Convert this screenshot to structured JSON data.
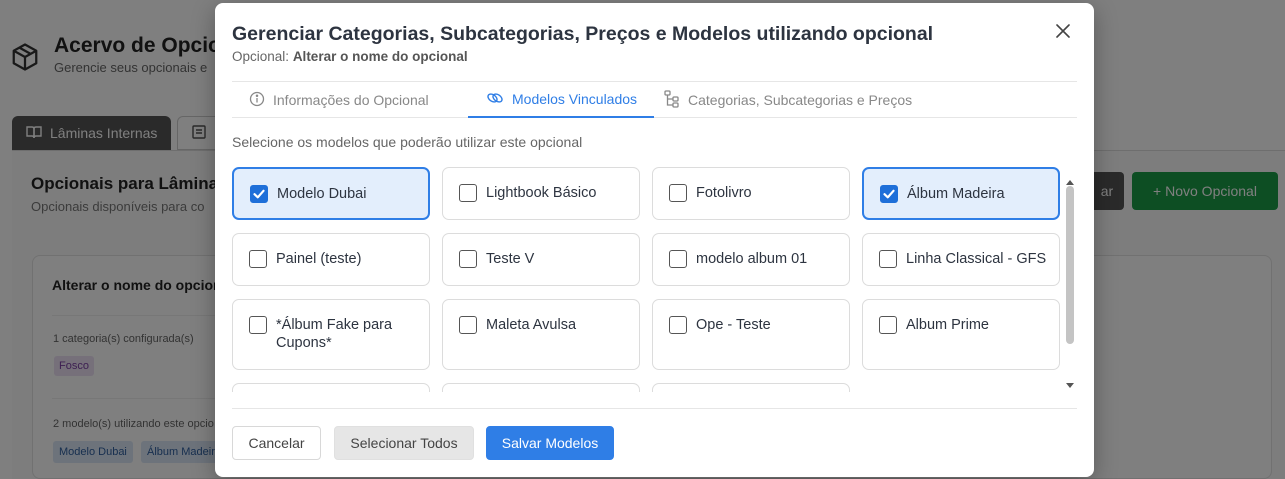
{
  "background": {
    "title": "Acervo de Opcior",
    "subtitle": "Gerencie seus opcionais e",
    "tabs": [
      {
        "label": "Lâminas Internas"
      },
      {
        "label": ""
      }
    ],
    "section_title": "Opcionais para Lâmina",
    "section_sub": "Opcionais disponíveis para co",
    "btn_dark_label": "ar",
    "btn_new_label": "+ Novo Opcional",
    "card_title": "Alterar o nome do opcion",
    "categories_text": "1 categoria(s) configurada(s)",
    "category_tag": "Fosco",
    "models_text": "2 modelo(s) utilizando este opcio",
    "model_tags": [
      "Modelo Dubai",
      "Álbum Madeir"
    ]
  },
  "modal": {
    "title": "Gerenciar Categorias, Subcategorias, Preços e Modelos utilizando opcional",
    "subtitle_prefix": "Opcional:",
    "subtitle_value": "Alterar o nome do opcional",
    "tabs": [
      {
        "label": "Informações do Opcional",
        "icon": "info-icon",
        "active": false
      },
      {
        "label": "Modelos Vinculados",
        "icon": "link-icon",
        "active": true
      },
      {
        "label": "Categorias, Subcategorias e Preços",
        "icon": "tree-icon",
        "active": false
      }
    ],
    "instruction": "Selecione os modelos que poderão utilizar este opcional",
    "models": [
      {
        "label": "Modelo Dubai",
        "checked": true
      },
      {
        "label": "Lightbook Básico",
        "checked": false
      },
      {
        "label": "Fotolivro",
        "checked": false
      },
      {
        "label": "Álbum Madeira",
        "checked": true
      },
      {
        "label": "Painel (teste)",
        "checked": false
      },
      {
        "label": "Teste V",
        "checked": false
      },
      {
        "label": "modelo album 01",
        "checked": false
      },
      {
        "label": "Linha Classical - GFS",
        "checked": false
      },
      {
        "label": "*Álbum Fake para Cupons*",
        "checked": false
      },
      {
        "label": "Maleta Avulsa",
        "checked": false
      },
      {
        "label": "Ope - Teste",
        "checked": false
      },
      {
        "label": "Album Prime",
        "checked": false
      }
    ],
    "buttons": {
      "cancel": "Cancelar",
      "select_all": "Selecionar Todos",
      "save": "Salvar Modelos"
    },
    "colors": {
      "accent": "#2f7ee6",
      "checked_bg": "#e3eefc",
      "green": "#1a9c46"
    }
  }
}
